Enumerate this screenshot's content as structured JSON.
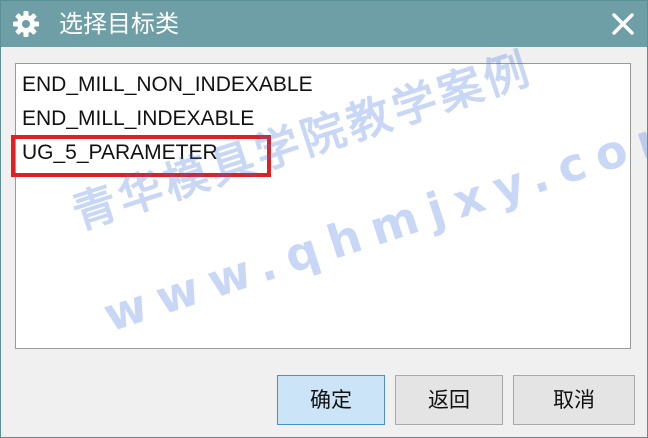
{
  "window": {
    "title": "选择目标类",
    "icon": "gear-icon",
    "close_icon": "close-icon",
    "titlebar_color": "#6e9fa6"
  },
  "list": {
    "items": [
      {
        "label": "END_MILL_NON_INDEXABLE"
      },
      {
        "label": "END_MILL_INDEXABLE"
      },
      {
        "label": "UG_5_PARAMETER",
        "highlighted": true
      }
    ],
    "highlight_color": "#e02020"
  },
  "watermark": {
    "line1": "青华模具学院教学案例",
    "line2": "www.qhmjxy.com",
    "color": "#3c6ee1"
  },
  "buttons": {
    "ok_label": "确定",
    "back_label": "返回",
    "cancel_label": "取消"
  }
}
